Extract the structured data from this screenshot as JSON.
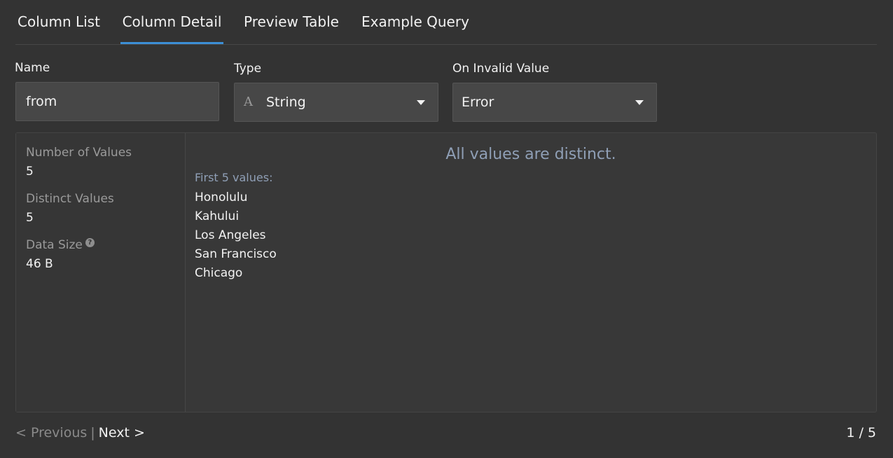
{
  "tabs": [
    {
      "label": "Column List"
    },
    {
      "label": "Column Detail"
    },
    {
      "label": "Preview Table"
    },
    {
      "label": "Example Query"
    }
  ],
  "active_tab": "Column Detail",
  "accent_color": "#3c8fd6",
  "form": {
    "name_label": "Name",
    "name_value": "from",
    "type_label": "Type",
    "type_icon": "string-type-icon",
    "type_glyph": "A",
    "type_value": "String",
    "invalid_label": "On Invalid Value",
    "invalid_value": "Error"
  },
  "stats": {
    "count_label": "Number of Values",
    "count_value": "5",
    "distinct_label": "Distinct Values",
    "distinct_value": "5",
    "size_label": "Data Size",
    "size_value": "46 B"
  },
  "values": {
    "message": "All values are distinct.",
    "header": "First 5 values:",
    "items": [
      "Honolulu",
      "Kahului",
      "Los Angeles",
      "San Francisco",
      "Chicago"
    ]
  },
  "pager": {
    "previous_label": "< Previous",
    "separator": "|",
    "next_label": "Next >",
    "page_indicator": "1 / 5"
  }
}
